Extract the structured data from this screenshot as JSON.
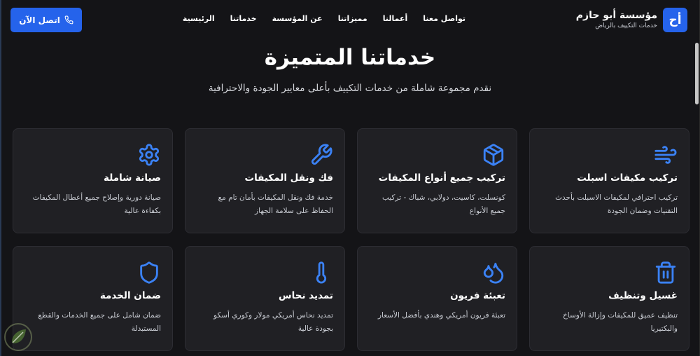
{
  "brand": {
    "logo_text": "أح",
    "name": "مؤسسة أبو حازم",
    "subtitle": "خدمات التكييف بالرياض"
  },
  "nav": {
    "items": [
      "الرئيسية",
      "خدماتنا",
      "عن المؤسسة",
      "مميزاتنا",
      "أعمالنا",
      "تواصل معنا"
    ]
  },
  "cta": {
    "label": "اتصل الآن",
    "icon": "phone-icon"
  },
  "hero": {
    "title": "خدماتنا المتميزة",
    "subtitle": "نقدم مجموعة شاملة من خدمات التكييف بأعلى معايير الجودة والاحترافية"
  },
  "services": [
    {
      "icon": "wind-icon",
      "title": "تركيب مكيفات اسبلت",
      "desc": "تركيب احترافي لمكيفات الاسبلت بأحدث التقنيات وضمان الجودة"
    },
    {
      "icon": "box-icon",
      "title": "تركيب جميع أنواع المكيفات",
      "desc": "كونسلت، كاسيت، دولابي، شباك - تركيب جميع الأنواع"
    },
    {
      "icon": "wrench-icon",
      "title": "فك ونقل المكيفات",
      "desc": "خدمة فك ونقل المكيفات بأمان تام مع الحفاظ على سلامة الجهاز"
    },
    {
      "icon": "gear-icon",
      "title": "صيانة شاملة",
      "desc": "صيانة دورية وإصلاح جميع أعطال المكيفات بكفاءة عالية"
    },
    {
      "icon": "trash-icon",
      "title": "غسيل وتنظيف",
      "desc": "تنظيف عميق للمكيفات وإزالة الأوساخ والبكتيريا"
    },
    {
      "icon": "droplets-icon",
      "title": "تعبئة فريون",
      "desc": "تعبئة فريون أمريكي وهندي بأفضل الأسعار"
    },
    {
      "icon": "thermometer-icon",
      "title": "تمديد نحاس",
      "desc": "تمديد نحاس أمريكي مولار وكوري أسكو بجودة عالية"
    },
    {
      "icon": "shield-icon",
      "title": "ضمان الخدمة",
      "desc": "ضمان شامل على جميع الخدمات والقطع المستبدلة"
    }
  ],
  "colors": {
    "accent": "#2563eb",
    "icon": "#3b82f6",
    "background": "#141417",
    "card": "#202024"
  }
}
